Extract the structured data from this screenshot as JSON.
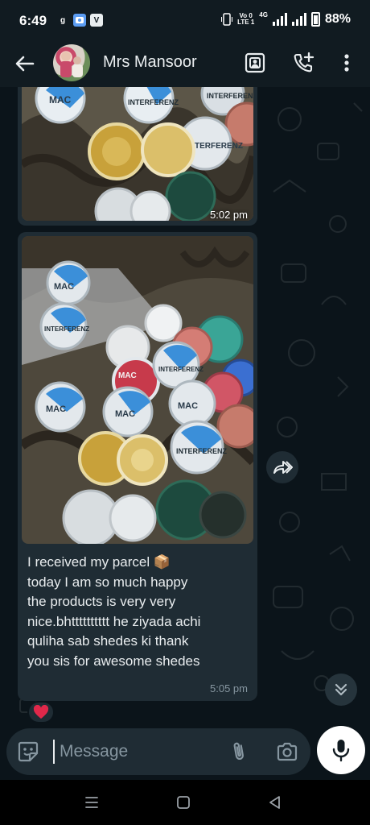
{
  "status_bar": {
    "time": "6:49",
    "app_icons": [
      "g",
      "",
      "V"
    ],
    "network": [
      "Vo 0",
      "LTE 1"
    ],
    "data": "4G",
    "battery": "88%"
  },
  "app_bar": {
    "contact_name": "Mrs Mansoor",
    "icons": [
      "back-arrow-icon",
      "video-call-icon",
      "add-call-icon",
      "more-vertical-icon"
    ]
  },
  "messages": [
    {
      "type": "image",
      "time": "5:02 pm"
    },
    {
      "type": "image_caption",
      "time": "5:05 pm",
      "text_lines": [
        "I received my parcel 📦",
        "today I am so much happy",
        "the products is very very",
        "nice.bhtttttttttt he ziyada achi",
        "quliha sab shedes ki thank",
        "you sis for awesome shedes"
      ],
      "reaction": "❤️"
    }
  ],
  "photo": {
    "pot_labels": [
      "MAC",
      "INTERFERENZ"
    ]
  },
  "composer": {
    "placeholder": "Message"
  },
  "colors": {
    "bar_bg": "#111b21",
    "chat_bg": "#0b141a",
    "bubble_bg": "#1f2c34",
    "text_primary": "#e9edef",
    "text_muted": "#8696a0",
    "reaction_red": "#e0284a"
  }
}
